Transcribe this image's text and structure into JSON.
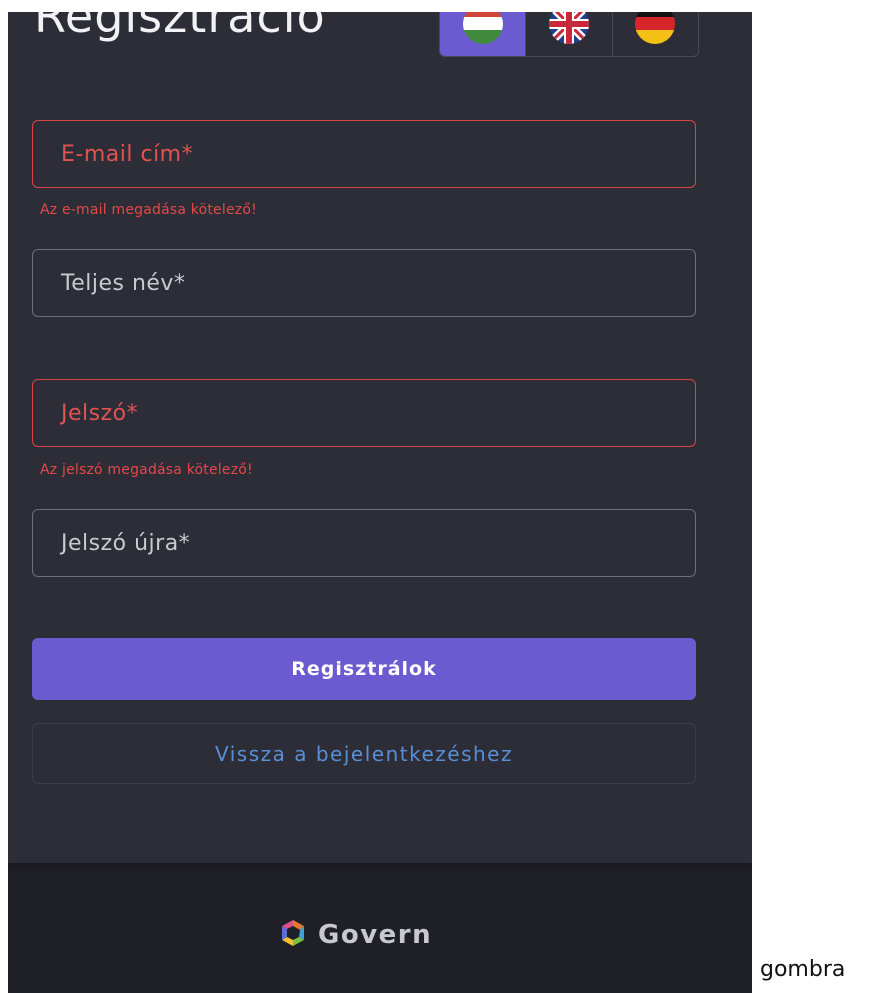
{
  "page": {
    "title": "Regisztráció"
  },
  "languages": [
    {
      "code": "hu",
      "name": "hungary-flag-icon",
      "active": true
    },
    {
      "code": "en",
      "name": "uk-flag-icon",
      "active": false
    },
    {
      "code": "de",
      "name": "germany-flag-icon",
      "active": false
    }
  ],
  "form": {
    "email": {
      "placeholder": "E-mail cím*",
      "error": "Az e-mail megadása kötelező!"
    },
    "fullname": {
      "placeholder": "Teljes név*"
    },
    "password": {
      "placeholder": "Jelszó*",
      "error": "Az jelszó megadása kötelező!"
    },
    "password_again": {
      "placeholder": "Jelszó újra*"
    }
  },
  "buttons": {
    "register": "Regisztrálok",
    "back_to_login": "Vissza a bejelentkezéshez"
  },
  "footer": {
    "brand": "Govern",
    "logo_icon": "govern-logo-icon"
  },
  "caption": "gombra",
  "colors": {
    "accent": "#6c5bd0",
    "error": "#e54848",
    "link": "#5a8fd6",
    "card": "#2c2d36",
    "background": "#1f1f27"
  }
}
